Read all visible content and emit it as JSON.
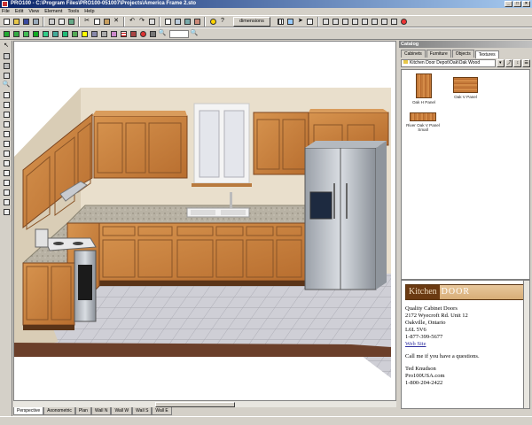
{
  "window": {
    "title": "PRO100 - C:\\Program Files\\PRO100-051007\\Projects\\America Frame 2.sto",
    "buttons": [
      "_",
      "□",
      "×"
    ]
  },
  "menu": [
    "File",
    "Edit",
    "View",
    "Element",
    "Tools",
    "Help"
  ],
  "toolbar": {
    "dimensions_label": "dimensions"
  },
  "view_tabs": [
    "Perspective",
    "Axonometric",
    "Plan",
    "Wall N",
    "Wall W",
    "Wall S",
    "Wall E"
  ],
  "catalog": {
    "title": "Catalog",
    "tabs": [
      "Cabinets",
      "Furniture",
      "Objects",
      "Textures"
    ],
    "active_tab": "Textures",
    "path": "Kitchen Door Depot\\Oak\\Oak Wood",
    "items": [
      {
        "label": "Oak H Panel"
      },
      {
        "label": "Oak V Panel"
      },
      {
        "label": "River Oak V Panel Small"
      }
    ]
  },
  "info": {
    "logo_left": "Kitchen",
    "logo_right": "DOOR",
    "company": "Quality Cabinet Doors",
    "address1": "2172 Wyecroft Rd. Unit 12",
    "address2": "Oakville, Ontario",
    "postal": "L6L 5V6",
    "phone": "1-877-399-5677",
    "website": "Web Site",
    "call": "Call me if you have a questions.",
    "contact_name": "Ted Knudson",
    "contact_site": "Pro100USA.com",
    "contact_phone": "1-800-204-2422"
  },
  "colors": {
    "titlebar": "#0a246a",
    "cabinet": "#c9823f",
    "wall": "#e7dcc8",
    "floor": "#c9c9cf"
  }
}
